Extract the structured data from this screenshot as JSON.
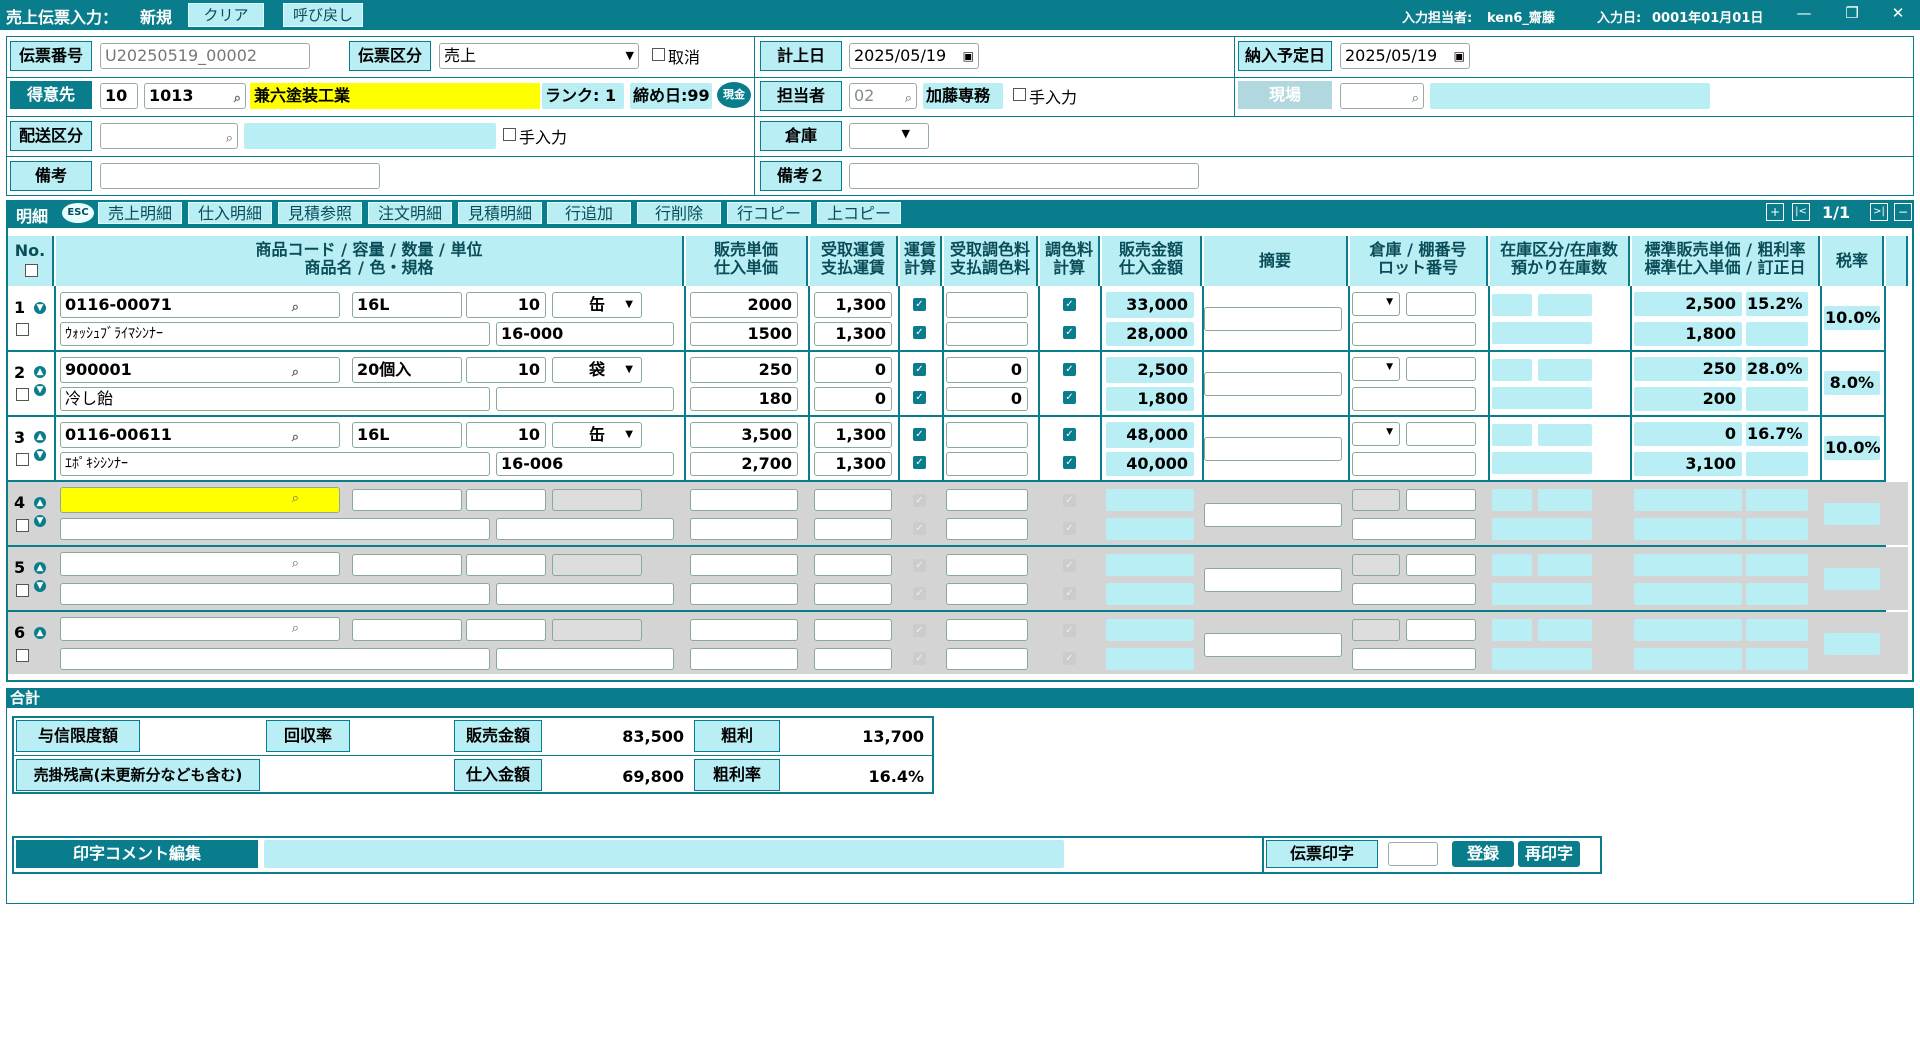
{
  "window": {
    "title": "売上伝票入力：",
    "mode": "新規",
    "clear_label": "クリア",
    "recall_label": "呼び戻し",
    "operator_label": "入力担当者:",
    "operator": "ken6_齋藤",
    "input_date_label": "入力日:",
    "input_date": "0001年01月01日",
    "min_icon": "—",
    "restore_icon": "❐",
    "close_icon": "✕"
  },
  "header": {
    "slip_no_label": "伝票番号",
    "slip_no": "U20250519_00002",
    "slip_type_label": "伝票区分",
    "slip_type": "売上",
    "cancel_label": "取消",
    "post_date_label": "計上日",
    "post_date": "2025/05/19",
    "delivery_date_label": "納入予定日",
    "delivery_date": "2025/05/19",
    "customer_label": "得意先",
    "customer_prefix": "10",
    "customer_code": "1013",
    "customer_name": "兼六塗装工業",
    "rank": "ランク: 1",
    "closing": "締め日:99",
    "cash_badge": "現金",
    "staff_label": "担当者",
    "staff_code": "02",
    "staff_name": "加藤専務",
    "manual_label": "手入力",
    "site_label": "現場",
    "ship_type_label": "配送区分",
    "ship_manual_label": "手入力",
    "warehouse_label": "倉庫",
    "memo_label": "備考",
    "memo2_label": "備考２"
  },
  "detail_bar": {
    "title": "明細",
    "esc": "ESC",
    "buttons": [
      "売上明細",
      "仕入明細",
      "見積参照",
      "注文明細",
      "見積明細",
      "行追加",
      "行削除",
      "行コピー",
      "上コピー"
    ],
    "page": "1/1"
  },
  "grid_headers": {
    "no": "No.",
    "product_1": "商品コード / 容量 / 数量 / 単位",
    "product_2": "商品名 / 色・規格",
    "price_1": "販売単価",
    "price_2": "仕入単価",
    "freight_1": "受取運賃",
    "freight_2": "支払運賃",
    "freightcalc_1": "運賃",
    "freightcalc_2": "計算",
    "color_1": "受取調色料",
    "color_2": "支払調色料",
    "colorcalc_1": "調色料",
    "colorcalc_2": "計算",
    "amount_1": "販売金額",
    "amount_2": "仕入金額",
    "summary": "摘要",
    "wh_1": "倉庫 / 棚番号",
    "wh_2": "ロット番号",
    "stock_1": "在庫区分/在庫数",
    "stock_2": "預かり在庫数",
    "std_1": "標準販売単価 / 粗利率",
    "std_2": "標準仕入単価 / 訂正日",
    "tax": "税率"
  },
  "rows": [
    {
      "no": "1",
      "code": "0116-00071",
      "capacity": "16L",
      "qty": "10",
      "unit": "缶",
      "name": "ｳｫｯｼｭﾌﾞﾗｲﾏｼﾝﾅｰ",
      "spec": "16-000",
      "sell_price": "2000",
      "buy_price": "1500",
      "recv_freight": "1,300",
      "pay_freight": "1,300",
      "recv_color": "",
      "pay_color": "",
      "sell_amount": "33,000",
      "buy_amount": "28,000",
      "std_sell": "2,500",
      "margin": "15.2%",
      "std_buy": "1,800",
      "tax": "10.0%"
    },
    {
      "no": "2",
      "code": "900001",
      "capacity": "20個入",
      "qty": "10",
      "unit": "袋",
      "name": "冷し飴",
      "spec": "",
      "sell_price": "250",
      "buy_price": "180",
      "recv_freight": "0",
      "pay_freight": "0",
      "recv_color": "0",
      "pay_color": "0",
      "sell_amount": "2,500",
      "buy_amount": "1,800",
      "std_sell": "250",
      "margin": "28.0%",
      "std_buy": "200",
      "tax": "8.0%"
    },
    {
      "no": "3",
      "code": "0116-00611",
      "capacity": "16L",
      "qty": "10",
      "unit": "缶",
      "name": "ｴﾎﾟｷｼｼﾝﾅｰ",
      "spec": "16-006",
      "sell_price": "3,500",
      "buy_price": "2,700",
      "recv_freight": "1,300",
      "pay_freight": "1,300",
      "recv_color": "",
      "pay_color": "",
      "sell_amount": "48,000",
      "buy_amount": "40,000",
      "std_sell": "0",
      "margin": "16.7%",
      "std_buy": "3,100",
      "tax": "10.0%"
    }
  ],
  "empty_rows": [
    "4",
    "5",
    "6"
  ],
  "totals": {
    "bar_label": "合計",
    "credit_label": "与信限度額",
    "recovery_label": "回収率",
    "sales_label": "販売金額",
    "sales": "83,500",
    "profit_label": "粗利",
    "profit": "13,700",
    "receivable_label": "売掛残高(未更新分なども含む)",
    "purchase_label": "仕入金額",
    "purchase": "69,800",
    "margin_label": "粗利率",
    "margin": "16.4%"
  },
  "footer": {
    "comment_label": "印字コメント編集",
    "print_label": "伝票印字",
    "register_label": "登録",
    "reprint_label": "再印字"
  }
}
